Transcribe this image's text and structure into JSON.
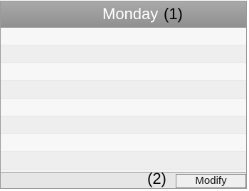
{
  "header": {
    "title": "Monday",
    "callout": "(1)"
  },
  "list": {
    "rows": [
      "",
      "",
      "",
      "",
      "",
      "",
      "",
      ""
    ]
  },
  "footer": {
    "callout": "(2)",
    "modify_label": "Modify"
  }
}
